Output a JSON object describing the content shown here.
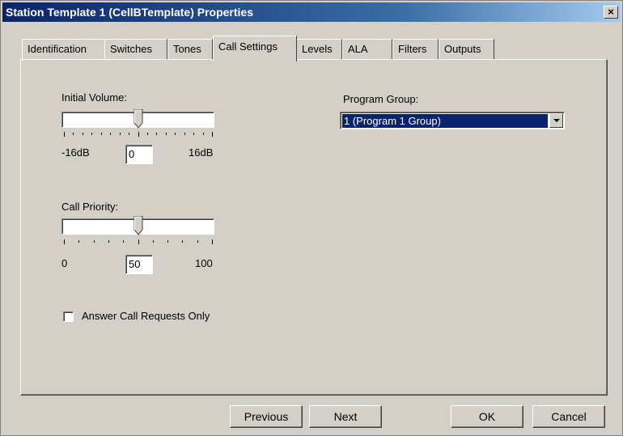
{
  "window": {
    "title": "Station Template 1 (CellBTemplate) Properties",
    "close_label": "×"
  },
  "tabs": [
    {
      "label": "Identification",
      "active": false
    },
    {
      "label": "Switches",
      "active": false
    },
    {
      "label": "Tones",
      "active": false
    },
    {
      "label": "Call Settings",
      "active": true
    },
    {
      "label": "Levels",
      "active": false
    },
    {
      "label": "ALA",
      "active": false
    },
    {
      "label": "Filters",
      "active": false
    },
    {
      "label": "Outputs",
      "active": false
    }
  ],
  "initial_volume": {
    "label": "Initial Volume:",
    "min_label": "-16dB",
    "max_label": "16dB",
    "value": "0",
    "slider_fraction": 0.5
  },
  "call_priority": {
    "label": "Call Priority:",
    "min_label": "0",
    "max_label": "100",
    "value": "50",
    "slider_fraction": 0.5
  },
  "answer_call_requests_only": {
    "label": "Answer Call Requests Only",
    "checked": false
  },
  "program_group": {
    "label": "Program Group:",
    "selected": "1 (Program 1 Group)"
  },
  "buttons": {
    "previous": "Previous",
    "next": "Next",
    "ok": "OK",
    "cancel": "Cancel"
  },
  "colors": {
    "dialog_bg": "#d4d0c8",
    "titlebar_start": "#0a246a",
    "titlebar_end": "#a6caf0",
    "selection": "#0a246a"
  }
}
